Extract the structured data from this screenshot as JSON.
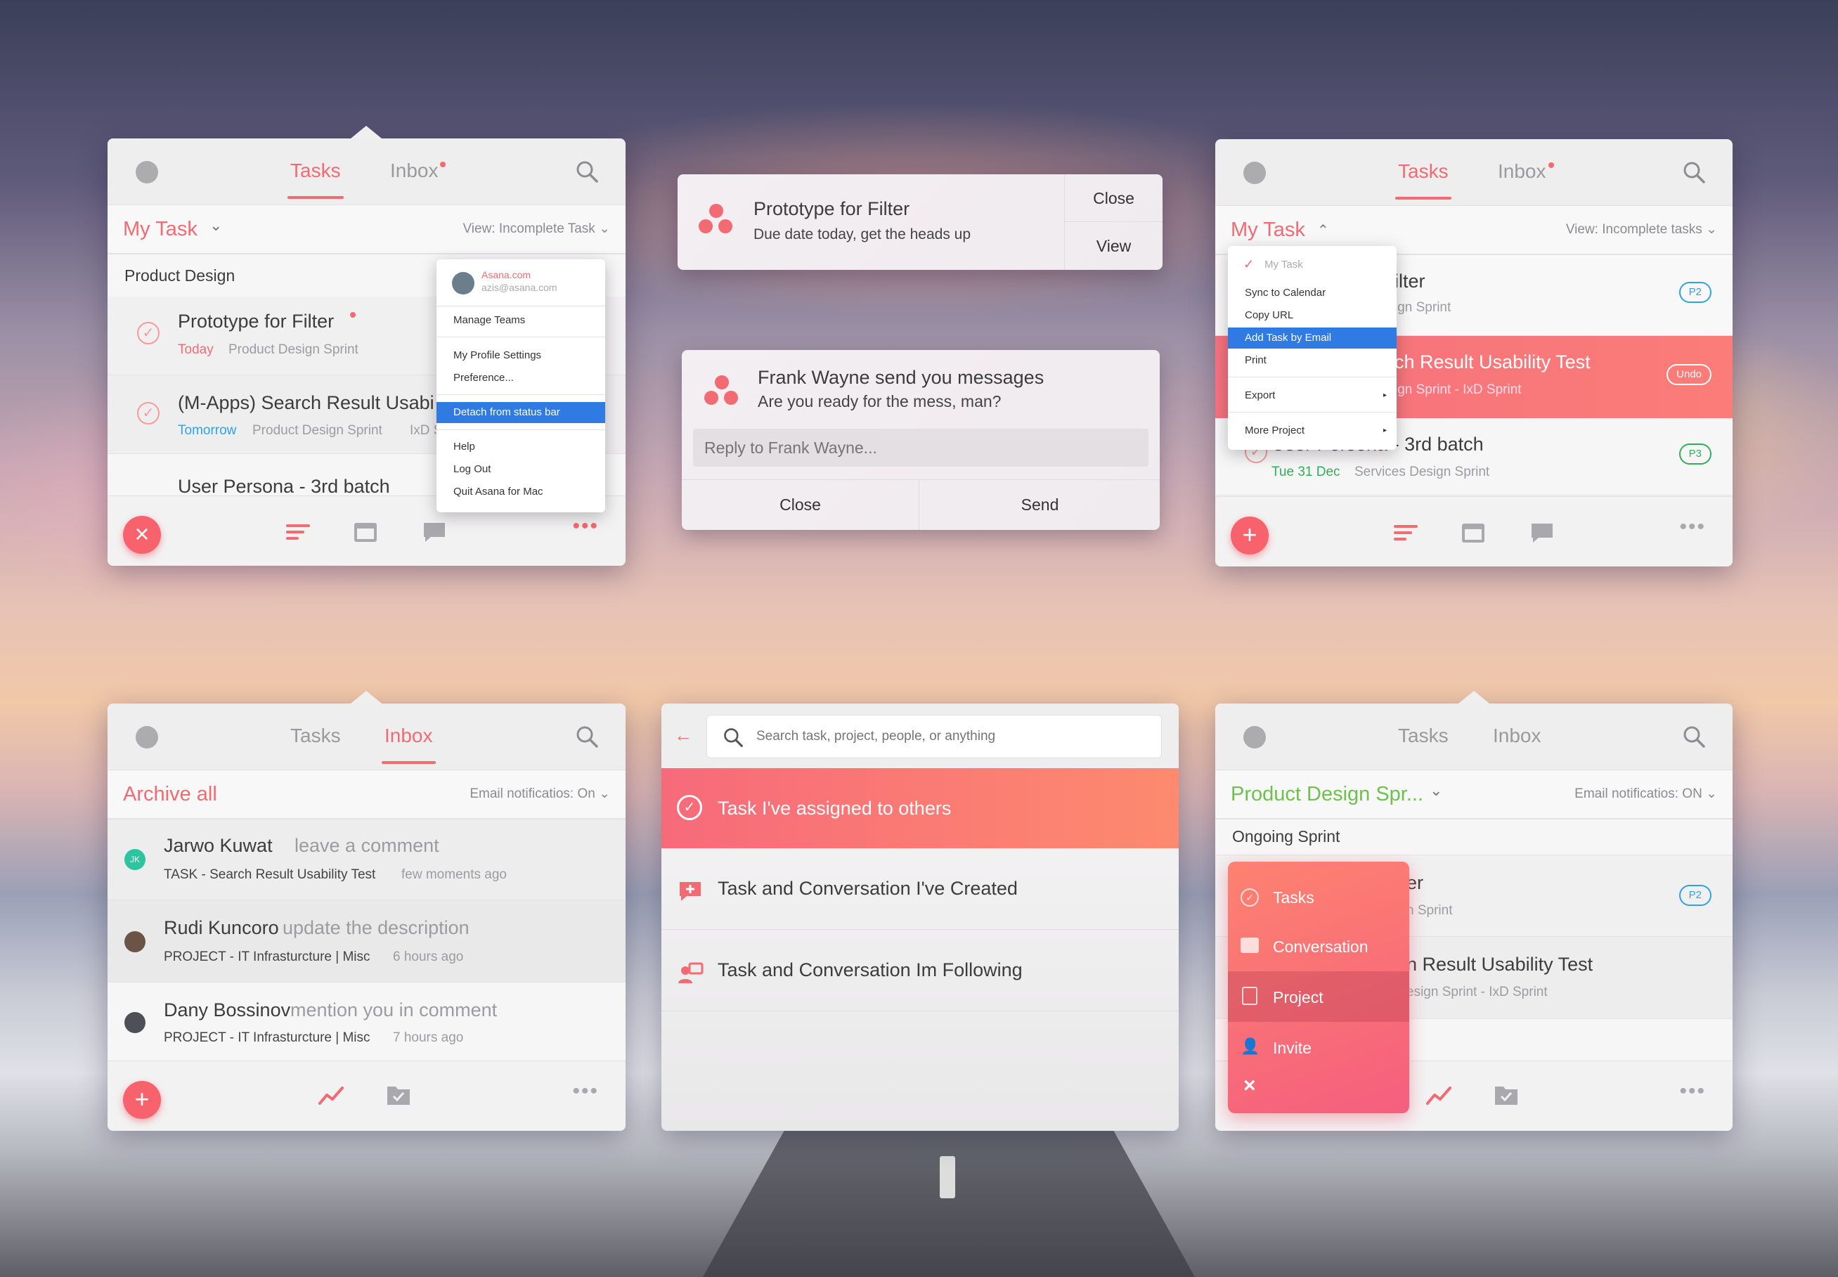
{
  "panel1": {
    "tabs": [
      "Tasks",
      "Inbox"
    ],
    "filter": "My Task",
    "view": "View: Incomplete Task",
    "section": "Product Design",
    "tasks": [
      {
        "title": "Prototype for Filter",
        "due": "Today",
        "project": "Product Design Sprint"
      },
      {
        "title": "(M-Apps) Search Result Usabi",
        "due": "Tomorrow",
        "project": "Product Design Sprint",
        "extra": "IxD S"
      },
      {
        "title": "User Persona - 3rd batch"
      }
    ],
    "menu": {
      "account_name": "Asana.com",
      "account_email": "azis@asana.com",
      "items": [
        "Manage Teams",
        "My Profile Settings",
        "Preference...",
        "Detach from status bar",
        "Help",
        "Log Out",
        "Quit Asana for Mac"
      ]
    },
    "fab": "×"
  },
  "notif1": {
    "title": "Prototype for Filter",
    "body": "Due date today, get the heads up",
    "close": "Close",
    "view": "View"
  },
  "notif2": {
    "title": "Frank Wayne send you messages",
    "body": "Are you ready for the mess, man?",
    "reply_placeholder": "Reply to Frank Wayne...",
    "close": "Close",
    "send": "Send"
  },
  "panel3": {
    "tabs": [
      "Tasks",
      "Inbox"
    ],
    "filter": "My Task",
    "view": "View: Incomplete tasks",
    "tasks": [
      {
        "title": "ilter",
        "project": "ign Sprint",
        "badge": "P2"
      },
      {
        "title": "ch Result Usability Test",
        "project": "ign Sprint  -  IxD Sprint",
        "badge": "Undo"
      },
      {
        "title": "User Persona - 3rd batch",
        "due": "Tue 31 Dec",
        "project": "Services Design Sprint",
        "badge": "P3"
      }
    ],
    "menu": {
      "items": [
        "My Task",
        "Sync to Calendar",
        "Copy URL",
        "Add Task by Email",
        "Print",
        "Export",
        "More Project"
      ]
    },
    "fab": "+"
  },
  "panel4": {
    "tabs": [
      "Tasks",
      "Inbox"
    ],
    "archive": "Archive all",
    "email": "Email notificatios: On",
    "items": [
      {
        "initials": "JK",
        "name": "Jarwo Kuwat",
        "action": "leave a comment",
        "context": "TASK - Search Result Usability Test",
        "time": "few moments ago"
      },
      {
        "name": "Rudi Kuncoro",
        "action": "update the description",
        "context": "PROJECT - IT Infrasturcture | Misc",
        "time": "6 hours ago"
      },
      {
        "name": "Dany Bossinov",
        "action": "mention you in comment",
        "context": "PROJECT - IT Infrasturcture | Misc",
        "time": "7 hours ago"
      }
    ],
    "fab": "+"
  },
  "panel5": {
    "search_placeholder": "Search task, project, people, or anything",
    "items": [
      "Task I've assigned to others",
      "Task and Conversation I've Created",
      "Task and Conversation Im Following"
    ]
  },
  "panel6": {
    "tabs": [
      "Tasks",
      "Inbox"
    ],
    "filter": "Product Design Spr...",
    "email": "Email notificatios: ON",
    "section": "Ongoing Sprint",
    "tasks": [
      {
        "title": "er",
        "project": "n Sprint",
        "badge": "P2"
      },
      {
        "title": "n Result Usability Test",
        "project": "esign Sprint  -  IxD Sprint"
      }
    ],
    "menu": [
      "Tasks",
      "Conversation",
      "Project",
      "Invite"
    ],
    "close": "×"
  }
}
